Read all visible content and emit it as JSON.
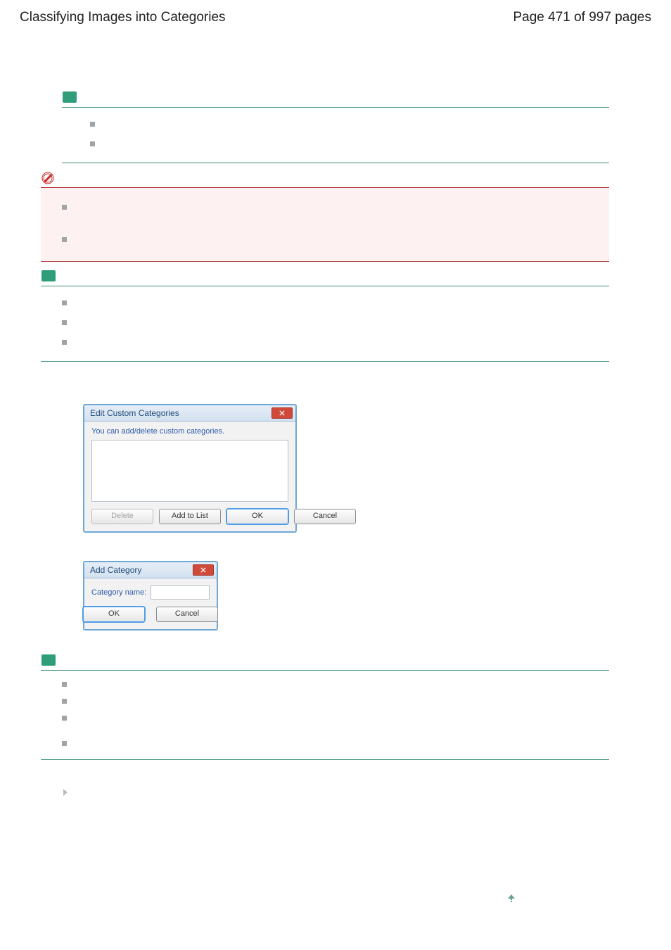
{
  "header": {
    "title": "Classifying Images into Categories",
    "page_indicator": "Page 471 of 997 pages"
  },
  "blocks": {
    "note1": {
      "bullets": [
        "",
        ""
      ]
    },
    "important1": {
      "bullets": [
        "",
        ""
      ]
    },
    "note2": {
      "bullets": [
        "",
        "",
        ""
      ]
    },
    "note3": {
      "bullets": [
        "",
        "",
        "",
        ""
      ]
    }
  },
  "dialogs": {
    "edit": {
      "title": "Edit Custom Categories",
      "message": "You can add/delete custom categories.",
      "buttons": {
        "delete": "Delete",
        "add": "Add to List",
        "ok": "OK",
        "cancel": "Cancel"
      }
    },
    "add": {
      "title": "Add Category",
      "label": "Category name:",
      "value": "",
      "buttons": {
        "ok": "OK",
        "cancel": "Cancel"
      }
    }
  },
  "icons": {
    "note": "note-icon",
    "important": "important-icon",
    "close": "close-icon",
    "chevron": "chevron-right-icon",
    "pagetop": "page-top-icon"
  }
}
